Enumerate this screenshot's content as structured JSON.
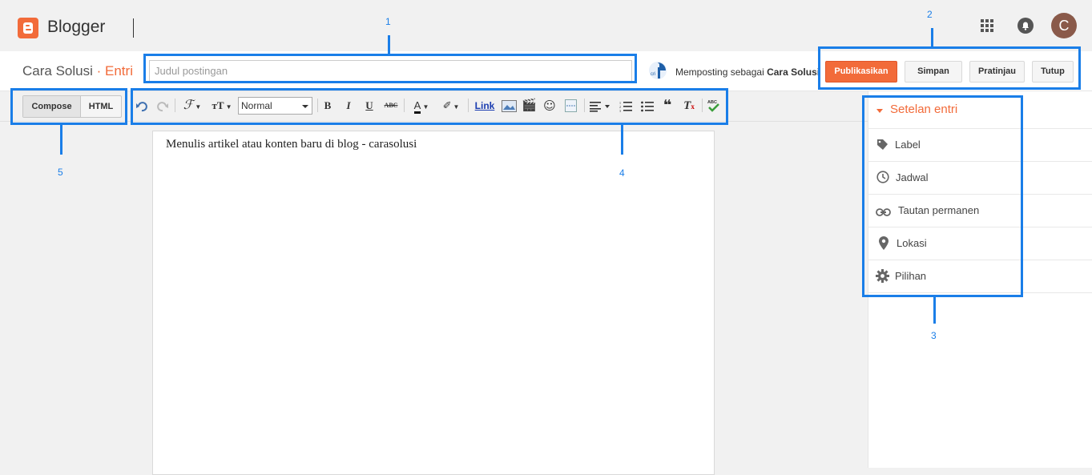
{
  "app": {
    "brand": "Blogger",
    "avatar_initial": "C"
  },
  "header": {
    "blog_name": "Cara Solusi",
    "separator": "·",
    "section": "Entri",
    "title_placeholder": "Judul postingan",
    "title_value": "",
    "posting_as_prefix": "Memposting sebagai",
    "posting_as_name": "Cara Solusi"
  },
  "actions": {
    "publish": "Publikasikan",
    "save": "Simpan",
    "preview": "Pratinjau",
    "close": "Tutup"
  },
  "modes": {
    "compose": "Compose",
    "html": "HTML"
  },
  "toolbar": {
    "format_value": "Normal",
    "link_label": "Link",
    "icons": [
      "undo-icon",
      "redo-icon",
      "font-family-icon",
      "font-size-icon",
      "bold-icon",
      "italic-icon",
      "underline-icon",
      "strikethrough-icon",
      "text-color-icon",
      "highlight-icon",
      "link",
      "image-icon",
      "video-icon",
      "emoji-icon",
      "jump-break-icon",
      "align-icon",
      "numbered-list-icon",
      "bulleted-list-icon",
      "quote-icon",
      "clear-format-icon",
      "spellcheck-icon"
    ]
  },
  "editor": {
    "content": "Menulis artikel atau konten baru di blog - carasolusi"
  },
  "settings": {
    "title": "Setelan entri",
    "items": [
      {
        "label": "Label",
        "icon": "tag-icon"
      },
      {
        "label": "Jadwal",
        "icon": "clock-icon"
      },
      {
        "label": "Tautan permanen",
        "icon": "link-icon"
      },
      {
        "label": "Lokasi",
        "icon": "location-pin-icon"
      },
      {
        "label": "Pilihan",
        "icon": "gear-icon"
      }
    ]
  },
  "annotations": {
    "one": "1",
    "two": "2",
    "three": "3",
    "four": "4",
    "five": "5"
  },
  "colors": {
    "accent": "#f26b3a",
    "annotation": "#1a7ee8"
  }
}
